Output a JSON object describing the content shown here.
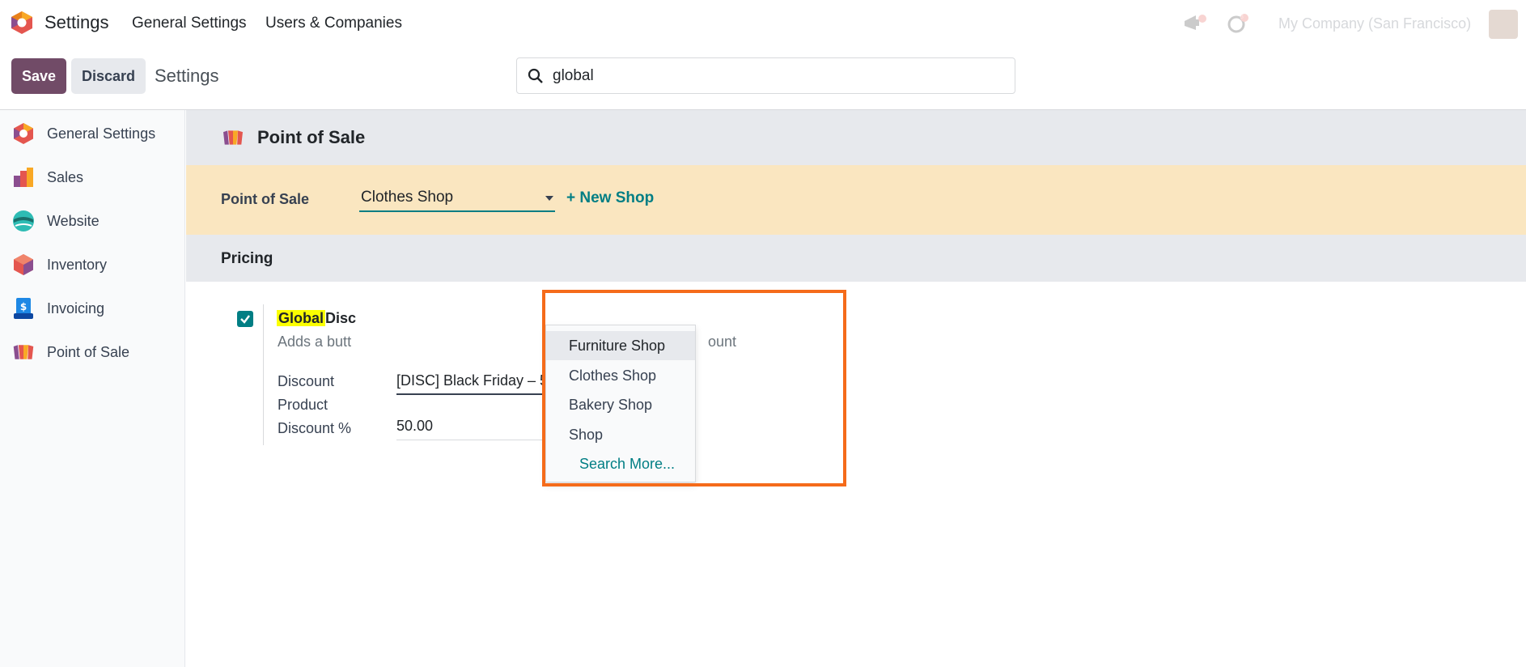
{
  "topbar": {
    "app_title": "Settings",
    "menu": [
      "General Settings",
      "Users & Companies"
    ],
    "company": "My Company (San Francisco)",
    "messages_badge": "1",
    "activity_badge": "3"
  },
  "control": {
    "save_label": "Save",
    "discard_label": "Discard",
    "breadcrumb": "Settings",
    "search_value": "global"
  },
  "sidebar": {
    "items": [
      {
        "label": "General Settings"
      },
      {
        "label": "Sales"
      },
      {
        "label": "Website"
      },
      {
        "label": "Inventory"
      },
      {
        "label": "Invoicing"
      },
      {
        "label": "Point of Sale"
      }
    ]
  },
  "main": {
    "section_title": "Point of Sale",
    "pos_label": "Point of Sale",
    "pos_value": "Clothes Shop",
    "new_shop_label": "+ New Shop",
    "pricing_title": "Pricing",
    "setting": {
      "title_highlight": "Global",
      "title_rest": "Disc",
      "desc_left": "Adds a butt",
      "desc_right": "ount",
      "discount_product_label_1": "Discount",
      "discount_product_label_2": "Product",
      "discount_product_value": "[DISC] Black Friday – 50",
      "discount_pct_label": "Discount %",
      "discount_pct_value": "50.00"
    }
  },
  "dropdown": {
    "options": [
      "Furniture Shop",
      "Clothes Shop",
      "Bakery Shop",
      "Shop"
    ],
    "search_more": "Search More..."
  },
  "colors": {
    "brand": "#714b67",
    "accent": "#017e84",
    "pos_row_bg": "#fae6c0",
    "highlight_box": "#f56b1a",
    "search_highlight": "#fbff00"
  }
}
